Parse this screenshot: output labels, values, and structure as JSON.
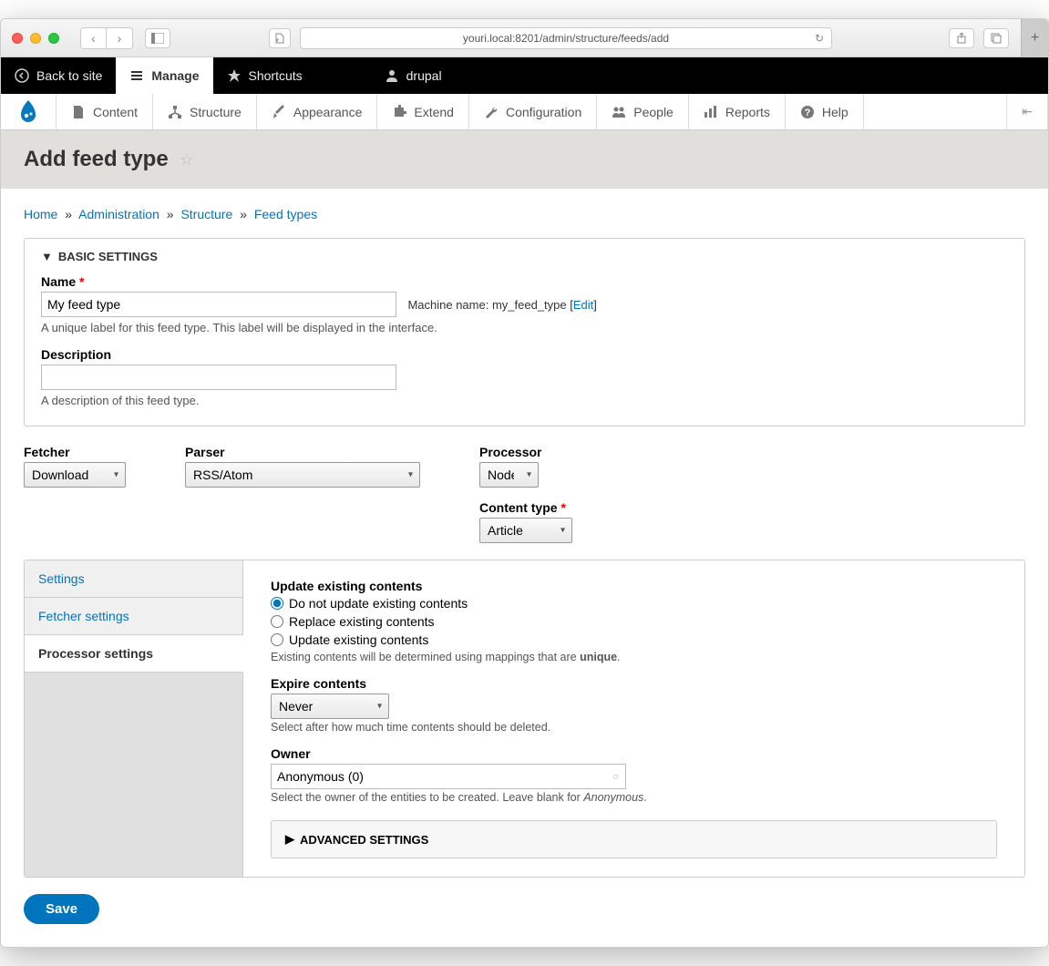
{
  "browser": {
    "url": "youri.local:8201/admin/structure/feeds/add"
  },
  "topbar": {
    "back_to_site": "Back to site",
    "manage": "Manage",
    "shortcuts": "Shortcuts",
    "user": "drupal"
  },
  "adminbar": {
    "items": [
      {
        "label": "Content"
      },
      {
        "label": "Structure"
      },
      {
        "label": "Appearance"
      },
      {
        "label": "Extend"
      },
      {
        "label": "Configuration"
      },
      {
        "label": "People"
      },
      {
        "label": "Reports"
      },
      {
        "label": "Help"
      }
    ]
  },
  "page_title": "Add feed type",
  "breadcrumb": {
    "home": "Home",
    "administration": "Administration",
    "structure": "Structure",
    "feed_types": "Feed types"
  },
  "basic": {
    "legend": "BASIC SETTINGS",
    "name_label": "Name",
    "name_value": "My feed type",
    "machine_name_prefix": "Machine name: ",
    "machine_name": "my_feed_type",
    "edit_link": "Edit",
    "name_desc": "A unique label for this feed type. This label will be displayed in the interface.",
    "desc_label": "Description",
    "desc_value": "",
    "desc_desc": "A description of this feed type."
  },
  "selectors": {
    "fetcher_label": "Fetcher",
    "fetcher_value": "Download",
    "parser_label": "Parser",
    "parser_value": "RSS/Atom",
    "processor_label": "Processor",
    "processor_value": "Node",
    "content_type_label": "Content type",
    "content_type_value": "Article"
  },
  "tabs": {
    "settings": "Settings",
    "fetcher": "Fetcher settings",
    "processor": "Processor settings"
  },
  "processor": {
    "update_heading": "Update existing contents",
    "radio1": "Do not update existing contents",
    "radio2": "Replace existing contents",
    "radio3": "Update existing contents",
    "update_desc_prefix": "Existing contents will be determined using mappings that are ",
    "update_desc_bold": "unique",
    "expire_label": "Expire contents",
    "expire_value": "Never",
    "expire_desc": "Select after how much time contents should be deleted.",
    "owner_label": "Owner",
    "owner_value": "Anonymous (0)",
    "owner_desc_prefix": "Select the owner of the entities to be created. Leave blank for ",
    "owner_desc_em": "Anonymous",
    "adv_legend": "ADVANCED SETTINGS"
  },
  "save_label": "Save"
}
